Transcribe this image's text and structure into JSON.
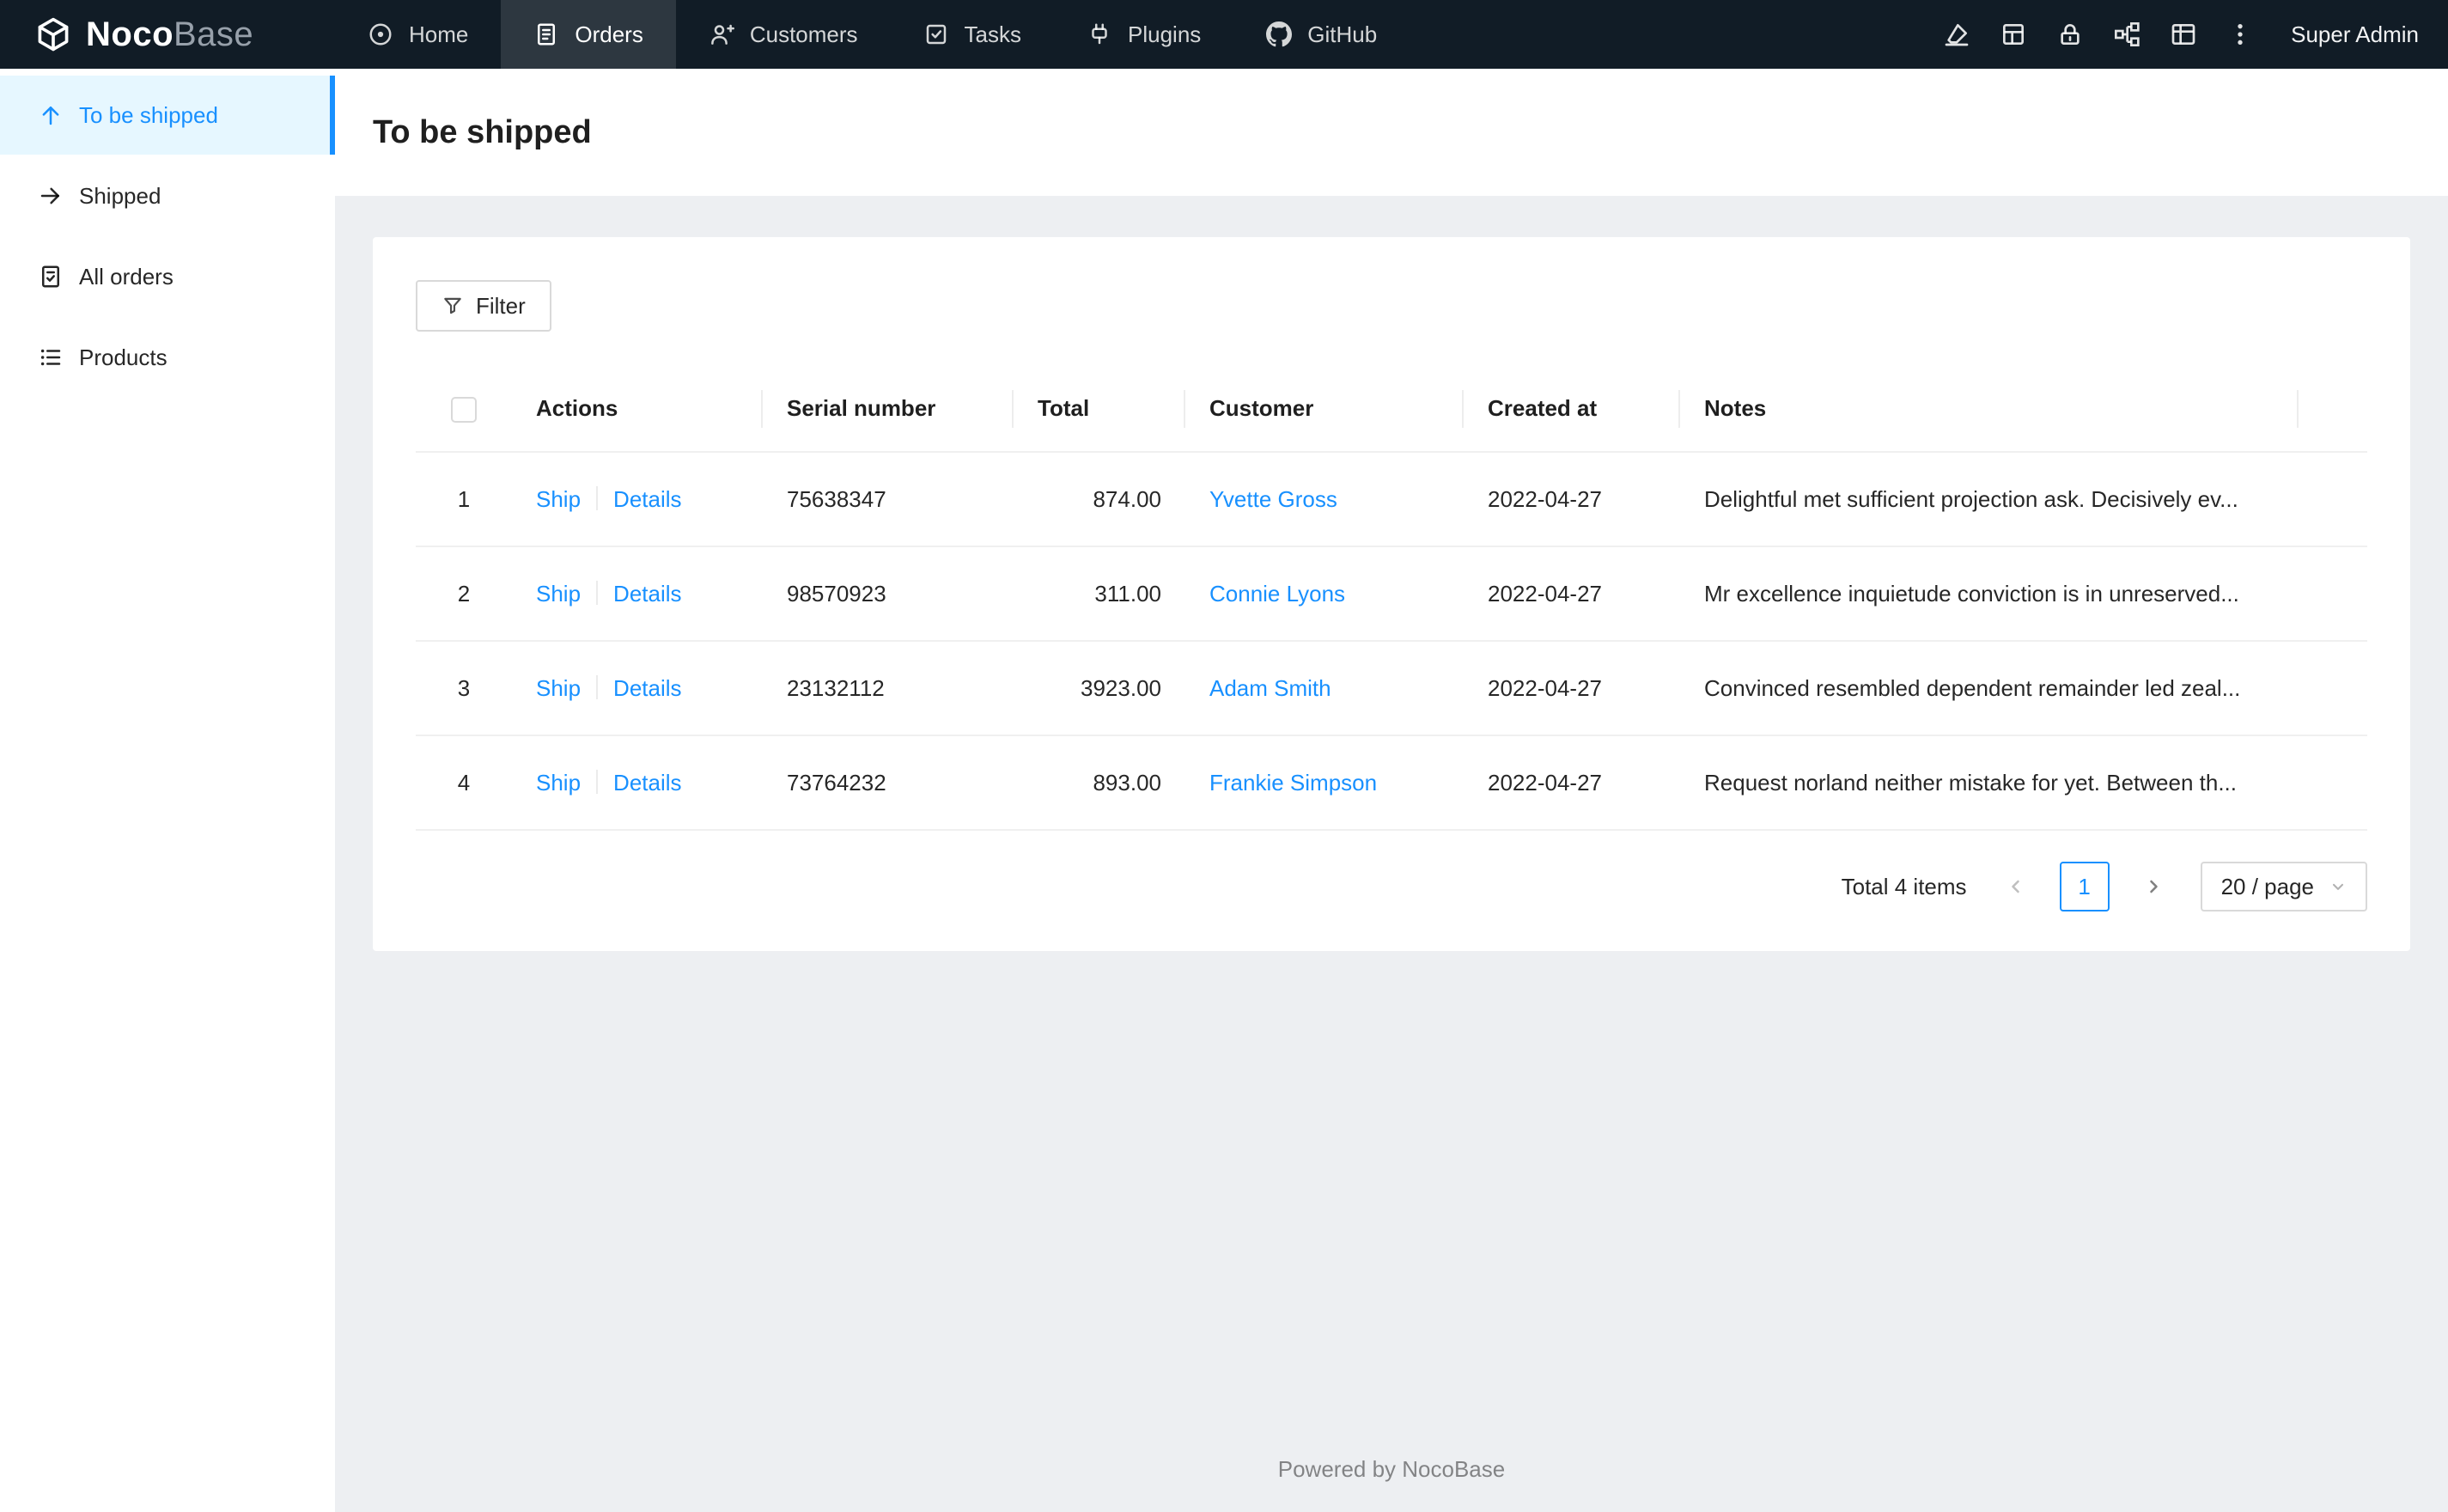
{
  "topbar": {
    "logo_noco": "Noco",
    "logo_base": "Base",
    "nav": [
      {
        "label": "Home"
      },
      {
        "label": "Orders"
      },
      {
        "label": "Customers"
      },
      {
        "label": "Tasks"
      },
      {
        "label": "Plugins"
      },
      {
        "label": "GitHub"
      }
    ],
    "right_icons": [
      "highlighter-icon",
      "collections-icon",
      "lock-icon",
      "partition-icon",
      "layout-icon",
      "more-icon"
    ],
    "user": "Super Admin"
  },
  "sidebar": {
    "items": [
      {
        "label": "To be shipped",
        "icon": "arrow-up-icon"
      },
      {
        "label": "Shipped",
        "icon": "arrow-right-icon"
      },
      {
        "label": "All orders",
        "icon": "order-file-icon"
      },
      {
        "label": "Products",
        "icon": "list-icon"
      }
    ]
  },
  "page": {
    "title": "To be shipped"
  },
  "toolbar": {
    "filter_label": "Filter"
  },
  "table": {
    "headers": {
      "actions": "Actions",
      "serial": "Serial number",
      "total": "Total",
      "customer": "Customer",
      "created": "Created at",
      "notes": "Notes"
    },
    "actions": {
      "ship": "Ship",
      "details": "Details"
    },
    "rows": [
      {
        "index": "1",
        "serial": "75638347",
        "total": "874.00",
        "customer": "Yvette Gross",
        "created": "2022-04-27",
        "notes": "Delightful met sufficient projection ask. Decisively ev..."
      },
      {
        "index": "2",
        "serial": "98570923",
        "total": "311.00",
        "customer": "Connie Lyons",
        "created": "2022-04-27",
        "notes": "Mr excellence inquietude conviction is in unreserved..."
      },
      {
        "index": "3",
        "serial": "23132112",
        "total": "3923.00",
        "customer": "Adam Smith",
        "created": "2022-04-27",
        "notes": "Convinced resembled dependent remainder led zeal..."
      },
      {
        "index": "4",
        "serial": "73764232",
        "total": "893.00",
        "customer": "Frankie Simpson",
        "created": "2022-04-27",
        "notes": "Request norland neither mistake for yet. Between th..."
      }
    ]
  },
  "pagination": {
    "total": "Total 4 items",
    "page": "1",
    "page_size": "20 / page"
  },
  "footer": "Powered by NocoBase",
  "colors": {
    "accent": "#1890ff",
    "topbar_bg": "#111c26",
    "active_item_bg": "#e6f7ff",
    "content_bg": "#edeff2"
  }
}
